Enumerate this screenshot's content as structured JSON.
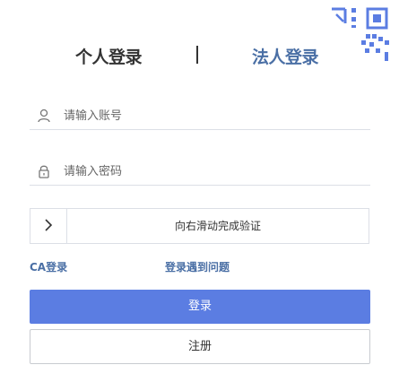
{
  "tabs": {
    "personal_label": "个人登录",
    "legal_label": "法人登录"
  },
  "account": {
    "placeholder": "请输入账号",
    "value": ""
  },
  "password": {
    "placeholder": "请输入密码",
    "value": ""
  },
  "slider": {
    "text": "向右滑动完成验证",
    "progress": 0
  },
  "links": {
    "ca_login": "CA登录",
    "login_problem": "登录遇到问题"
  },
  "buttons": {
    "login": "登录",
    "register": "注册"
  },
  "icons": {
    "qr_corner": "qr-code-icon",
    "account": "user-icon",
    "password": "lock-icon",
    "slider": "chevron-right-icon"
  },
  "colors": {
    "accent": "#5b7de2",
    "link": "#4a6fa5",
    "border": "#dcdfe6"
  }
}
